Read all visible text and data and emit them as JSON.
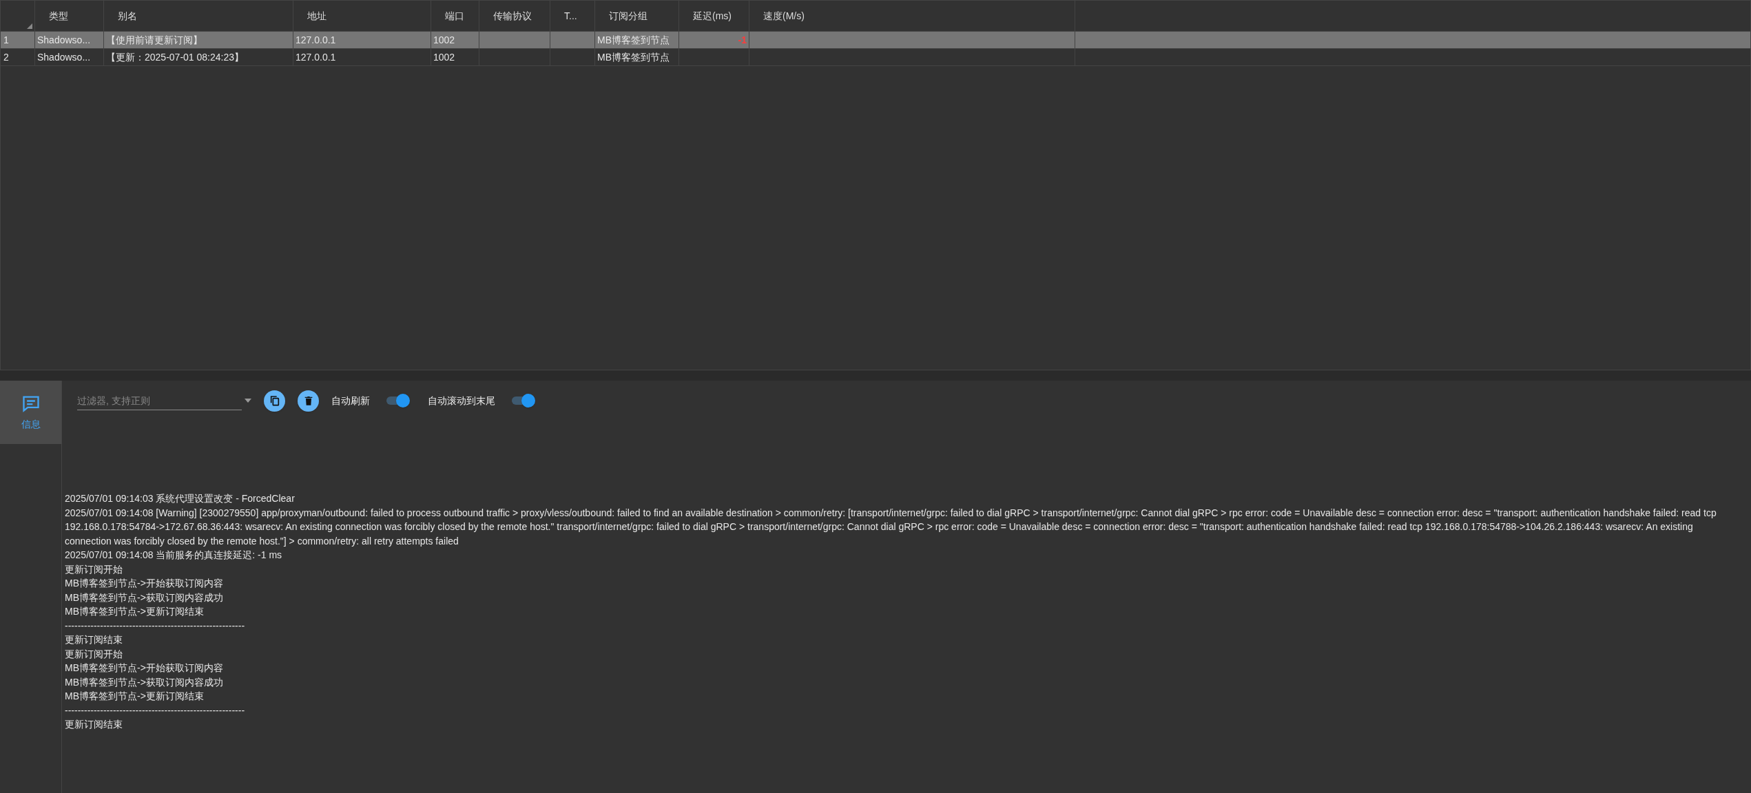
{
  "table": {
    "columns": [
      "类型",
      "别名",
      "地址",
      "端口",
      "传输协议",
      "T...",
      "订阅分组",
      "延迟(ms)",
      "速度(M/s)"
    ],
    "rows": [
      {
        "index": "1",
        "selected": true,
        "cells": [
          "Shadowso...",
          "【使用前请更新订阅】",
          "127.0.0.1",
          "1002",
          "",
          "",
          "MB博客签到节点",
          "-1",
          ""
        ]
      },
      {
        "index": "2",
        "selected": false,
        "cells": [
          "Shadowso...",
          "【更新：2025-07-01 08:24:23】",
          "127.0.0.1",
          "1002",
          "",
          "",
          "MB博客签到节点",
          "",
          ""
        ]
      }
    ]
  },
  "sidebar": {
    "items": [
      {
        "label": "信息",
        "selected": true
      }
    ]
  },
  "toolbar": {
    "filter": {
      "placeholder": "过滤器, 支持正则"
    },
    "toggles": [
      {
        "label": "自动刷新",
        "on": true
      },
      {
        "label": "自动滚动到末尾",
        "on": true
      }
    ]
  },
  "log": [
    "2025/07/01 09:14:03 系统代理设置改变 - ForcedClear",
    "2025/07/01 09:14:08 [Warning] [2300279550] app/proxyman/outbound: failed to process outbound traffic > proxy/vless/outbound: failed to find an available destination > common/retry: [transport/internet/grpc: failed to dial gRPC > transport/internet/grpc: Cannot dial gRPC > rpc error: code = Unavailable desc = connection error: desc = \"transport: authentication handshake failed: read tcp 192.168.0.178:54784->172.67.68.36:443: wsarecv: An existing connection was forcibly closed by the remote host.\" transport/internet/grpc: failed to dial gRPC > transport/internet/grpc: Cannot dial gRPC > rpc error: code = Unavailable desc = connection error: desc = \"transport: authentication handshake failed: read tcp 192.168.0.178:54788->104.26.2.186:443: wsarecv: An existing connection was forcibly closed by the remote host.\"] > common/retry: all retry attempts failed",
    "2025/07/01 09:14:08 当前服务的真连接延迟: -1 ms",
    "更新订阅开始",
    "MB博客签到节点->开始获取订阅内容",
    "MB博客签到节点->获取订阅内容成功",
    "MB博客签到节点->更新订阅结束",
    "--------------------------------------------------------",
    "更新订阅结束",
    "更新订阅开始",
    "MB博客签到节点->开始获取订阅内容",
    "MB博客签到节点->获取订阅内容成功",
    "MB博客签到节点->更新订阅结束",
    "--------------------------------------------------------",
    "更新订阅结束"
  ]
}
